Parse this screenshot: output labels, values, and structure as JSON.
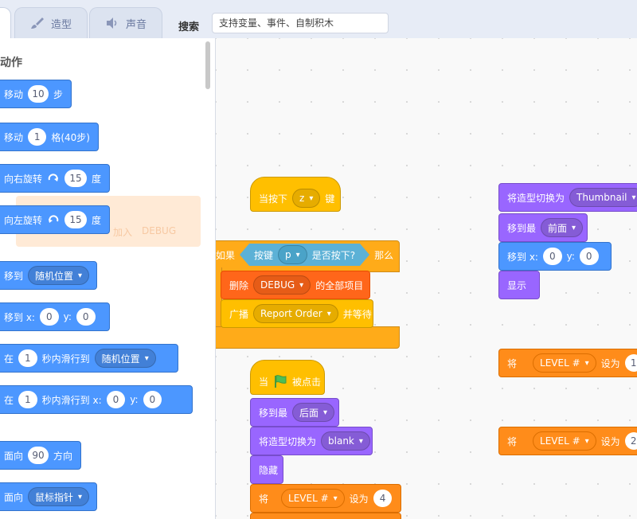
{
  "tabs": [
    {
      "label": "",
      "icon": "code-icon",
      "active": true
    },
    {
      "label": "造型",
      "icon": "brush-icon"
    },
    {
      "label": "声音",
      "icon": "speaker-icon"
    }
  ],
  "search": {
    "label": "搜索",
    "value": "支持变量、事件、自制积木"
  },
  "palette": {
    "section_title": "动作",
    "move": {
      "text": "移动",
      "value": "10",
      "unit": "步"
    },
    "move_grid": {
      "text": "移动",
      "value": "1",
      "unit": "格(40步)"
    },
    "turn_right": {
      "text": "向右旋转",
      "value": "15",
      "unit": "度"
    },
    "turn_left": {
      "text": "向左旋转",
      "value": "15",
      "unit": "度"
    },
    "goto": {
      "text": "移到",
      "dropdown": "随机位置"
    },
    "goto_xy": {
      "text": "移到 x:",
      "x": "0",
      "y_label": "y:",
      "y": "0"
    },
    "glide": {
      "prefix": "在",
      "value": "1",
      "text": "秒内滑行到",
      "dropdown": "随机位置"
    },
    "glide_xy": {
      "prefix": "在",
      "value": "1",
      "text": "秒内滑行到 x:",
      "x": "0",
      "y_label": "y:",
      "y": "0"
    },
    "point_dir": {
      "text": "面向",
      "value": "90",
      "unit": "方向"
    },
    "point_towards": {
      "text": "面向",
      "dropdown": "鼠标指针"
    },
    "ghost_add": {
      "text": "加入",
      "dropdown": "DEBUG"
    }
  },
  "scripts": {
    "key_hat": {
      "text": "当按下",
      "key": "z",
      "suffix": "键"
    },
    "if_block": {
      "if": "如果",
      "sensing": "按键",
      "key": "p",
      "sensing_suffix": "是否按下?",
      "then": "那么"
    },
    "delete_all": {
      "text": "删除",
      "list": "DEBUG",
      "suffix": "的全部项目"
    },
    "broadcast_wait": {
      "text": "广播",
      "message": "Report Order",
      "suffix": "并等待"
    },
    "flag_hat": {
      "prefix": "当",
      "suffix": "被点击"
    },
    "go_back": {
      "text": "移到最",
      "dropdown": "后面"
    },
    "switch_blank": {
      "text": "将造型切换为",
      "dropdown": "blank"
    },
    "hide": {
      "text": "隐藏"
    },
    "set_level_4": {
      "prefix": "将",
      "var": "LEVEL #",
      "text": "设为",
      "value": "4"
    },
    "switch_thumb": {
      "text": "将造型切换为",
      "dropdown": "Thumbnail"
    },
    "go_front": {
      "text": "移到最",
      "dropdown": "前面"
    },
    "goto_xy2": {
      "text": "移到 x:",
      "x": "0",
      "y_label": "y:",
      "y": "0"
    },
    "show": {
      "text": "显示"
    },
    "set_level_1": {
      "prefix": "将",
      "var": "LEVEL #",
      "text": "设为",
      "value": "1"
    },
    "set_level_2": {
      "prefix": "将",
      "var": "LEVEL #",
      "text": "设为",
      "value": "2"
    }
  },
  "colors": {
    "motion": "#4c97ff",
    "looks": "#9966ff",
    "events": "#ffbf00",
    "control": "#ffab19",
    "sensing": "#5cb1d6",
    "variables": "#ff8c1a",
    "lists": "#ff661a"
  }
}
